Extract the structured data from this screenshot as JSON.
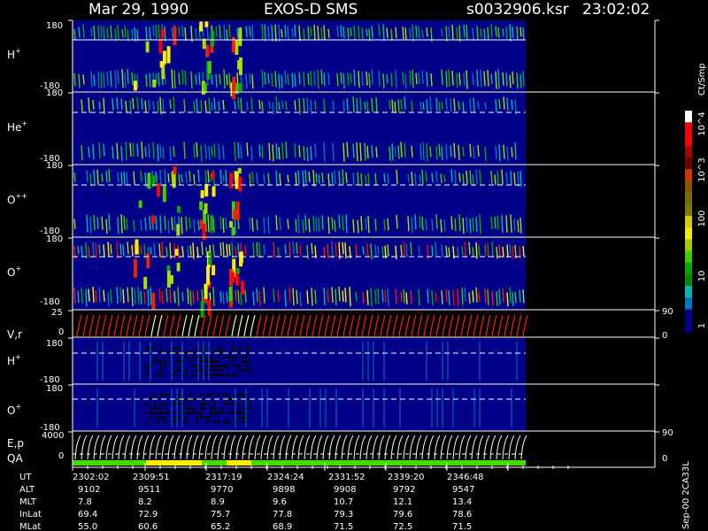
{
  "header": {
    "date": "Mar 29, 1990",
    "title": "EXOS-D SMS",
    "file": "s0032906.ksr",
    "time": "23:02:02"
  },
  "colorbar": {
    "unit": "Ct/Smp",
    "ticks": [
      "10^4",
      "10^3",
      "100",
      "10",
      "1"
    ],
    "colors": [
      "#ffffff",
      "#ff0000",
      "#ff0000",
      "#aa0000",
      "#660000",
      "#c83a00",
      "#885500",
      "#706e00",
      "#807800",
      "#d4cc00",
      "#eeee00",
      "#aac800",
      "#44c800",
      "#00aa00",
      "#008800",
      "#00b8b0",
      "#0077bb",
      "#000088",
      "#000088"
    ]
  },
  "chart_data": [
    {
      "type": "heatmap",
      "panels": [
        {
          "id": "h-plus",
          "label": "H",
          "superscript": "+",
          "y_range": [
            -180,
            180
          ],
          "y_ticks": [
            "180",
            "-180"
          ]
        },
        {
          "id": "he-plus",
          "label": "He",
          "superscript": "+",
          "y_range": [
            -180,
            180
          ],
          "y_ticks": [
            "180",
            "-180"
          ]
        },
        {
          "id": "o-plusplus",
          "label": "O",
          "superscript": "++",
          "y_range": [
            -180,
            180
          ],
          "y_ticks": [
            "180",
            "-180"
          ]
        },
        {
          "id": "o-plus",
          "label": "O",
          "superscript": "+",
          "y_range": [
            -180,
            180
          ],
          "y_ticks": [
            "180",
            "-180"
          ]
        }
      ],
      "x": [
        "2302:02",
        "2309:51",
        "2317:19",
        "2324:24",
        "2331:52",
        "2339:20",
        "2346:48"
      ]
    },
    {
      "type": "line",
      "id": "vr",
      "label": "V,r",
      "y_left_ticks": [
        "25",
        "0"
      ],
      "y_right_ticks": [
        "90",
        "0"
      ]
    },
    {
      "type": "heatmap",
      "panels": [
        {
          "id": "h-plus-2",
          "label": "H",
          "superscript": "+",
          "y_range": [
            -180,
            180
          ],
          "y_ticks": [
            "180",
            "-180"
          ]
        },
        {
          "id": "o-plus-2",
          "label": "O",
          "superscript": "+",
          "y_range": [
            -180,
            180
          ],
          "y_ticks": [
            "180",
            "-180"
          ]
        }
      ]
    },
    {
      "type": "line",
      "id": "ep",
      "label": "E,p",
      "label2": "QA",
      "y_left_ticks": [
        "4000",
        "0"
      ],
      "y_right_ticks": [
        "90",
        "0"
      ]
    }
  ],
  "ephemeris": {
    "rows": [
      {
        "name": "UT",
        "values": [
          "2302:02",
          "2309:51",
          "2317:19",
          "2324:24",
          "2331:52",
          "2339:20",
          "2346:48"
        ]
      },
      {
        "name": "ALT",
        "values": [
          "9102",
          "9511",
          "9770",
          "9898",
          "9908",
          "9792",
          "9547"
        ]
      },
      {
        "name": "MLT",
        "values": [
          "7.8",
          "8.2",
          "8.9",
          "9.6",
          "10.7",
          "12.1",
          "13.4"
        ]
      },
      {
        "name": "InLat",
        "values": [
          "69.4",
          "72.9",
          "75.7",
          "77.8",
          "79.3",
          "79.6",
          "78.6"
        ]
      },
      {
        "name": "MLat",
        "values": [
          "55.0",
          "60.6",
          "65.2",
          "68.9",
          "71.5",
          "72.5",
          "71.5"
        ]
      }
    ]
  },
  "side_note": "Sep-00 2CA33L"
}
